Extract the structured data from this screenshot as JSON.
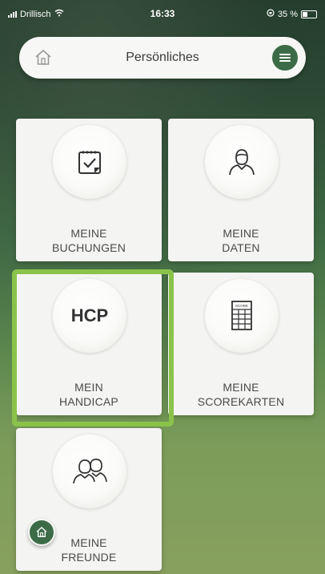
{
  "status_bar": {
    "carrier": "Drillisch",
    "time": "16:33",
    "battery_text": "35 %"
  },
  "header": {
    "title": "Persönliches",
    "home_icon": "home-icon",
    "menu_icon": "menu-icon"
  },
  "tiles": [
    {
      "line1": "MEINE",
      "line2": "BUCHUNGEN",
      "icon": "booking-icon"
    },
    {
      "line1": "MEINE",
      "line2": "DATEN",
      "icon": "user-icon"
    },
    {
      "line1": "MEIN",
      "line2": "HANDICAP",
      "icon_text": "HCP"
    },
    {
      "line1": "MEINE",
      "line2": "SCOREKARTEN",
      "icon": "scorecard-icon",
      "icon_caption": "SCORE"
    },
    {
      "line1": "MEINE",
      "line2": "FREUNDE",
      "icon": "friends-icon"
    }
  ],
  "colors": {
    "accent_green": "#3c6c47",
    "highlight": "#8bc34a",
    "tile_bg": "#f4f4f2"
  }
}
